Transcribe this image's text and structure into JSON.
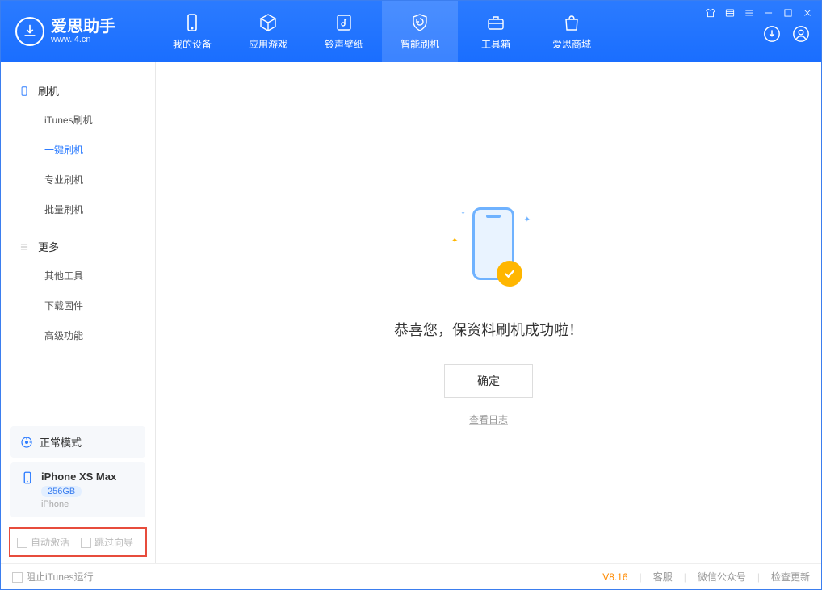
{
  "app": {
    "name": "爱思助手",
    "url": "www.i4.cn"
  },
  "nav": [
    {
      "label": "我的设备",
      "icon": "device"
    },
    {
      "label": "应用游戏",
      "icon": "cube"
    },
    {
      "label": "铃声壁纸",
      "icon": "music"
    },
    {
      "label": "智能刷机",
      "icon": "shield",
      "active": true
    },
    {
      "label": "工具箱",
      "icon": "toolbox"
    },
    {
      "label": "爱思商城",
      "icon": "bag"
    }
  ],
  "sidebar": {
    "sections": [
      {
        "title": "刷机",
        "items": [
          {
            "label": "iTunes刷机"
          },
          {
            "label": "一键刷机",
            "active": true
          },
          {
            "label": "专业刷机"
          },
          {
            "label": "批量刷机"
          }
        ]
      },
      {
        "title": "更多",
        "items": [
          {
            "label": "其他工具"
          },
          {
            "label": "下载固件"
          },
          {
            "label": "高级功能"
          }
        ]
      }
    ],
    "mode": "正常模式",
    "device": {
      "name": "iPhone XS Max",
      "capacity": "256GB",
      "type": "iPhone"
    },
    "checks": {
      "auto_activate": "自动激活",
      "skip_guide": "跳过向导"
    }
  },
  "main": {
    "success_msg": "恭喜您，保资料刷机成功啦！",
    "confirm": "确定",
    "view_log": "查看日志"
  },
  "status": {
    "block_itunes": "阻止iTunes运行",
    "version": "V8.16",
    "support": "客服",
    "wechat": "微信公众号",
    "check_update": "检查更新"
  }
}
